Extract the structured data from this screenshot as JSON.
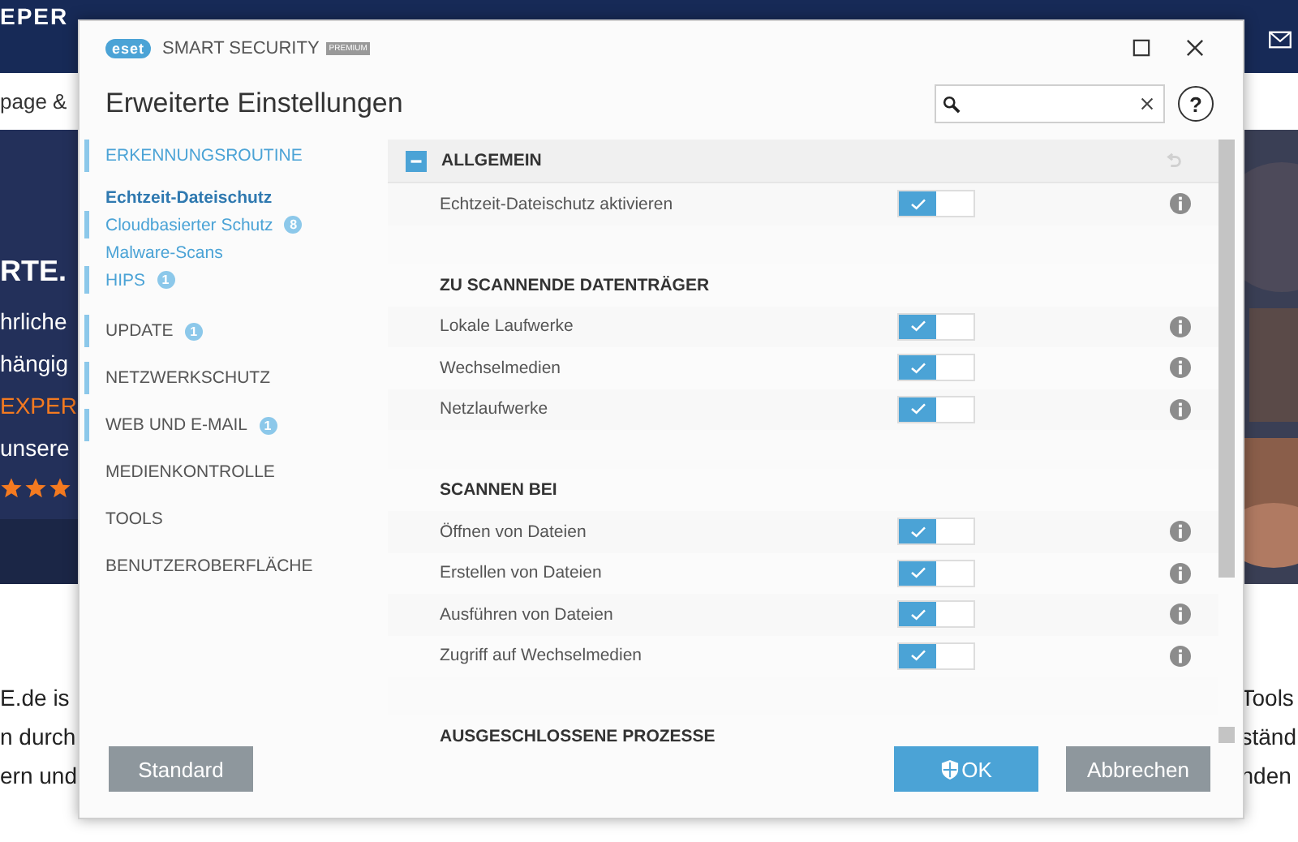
{
  "background_page": {
    "logo": "EPER",
    "nav_text": "page &",
    "hero_left": [
      {
        "text": "RTE.",
        "kind": "heading"
      },
      {
        "text": "hrliche",
        "kind": "plain"
      },
      {
        "text": "hängig",
        "kind": "plain"
      },
      {
        "text": "EXPER",
        "kind": "accent"
      },
      {
        "text": "unsere",
        "kind": "plain"
      }
    ],
    "stars": 3,
    "body_left": [
      "E.de is",
      "n durch",
      "ern und"
    ],
    "body_right": [
      "Tools",
      "ständ",
      "nden"
    ]
  },
  "window": {
    "brand": "eset",
    "product": "SMART SECURITY",
    "edition": "PREMIUM",
    "title": "Erweiterte Einstellungen",
    "help": "?"
  },
  "sidebar": {
    "items": [
      {
        "label": "ERKENNUNGSROUTINE",
        "marked": true,
        "selected": true,
        "children": [
          {
            "label": "Echtzeit-Dateischutz",
            "marked": false,
            "selected": true
          },
          {
            "label": "Cloudbasierter Schutz",
            "marked": true,
            "selected": false,
            "badge": "8"
          },
          {
            "label": "Malware-Scans",
            "marked": false,
            "selected": false
          },
          {
            "label": "HIPS",
            "marked": true,
            "selected": false,
            "badge": "1"
          }
        ]
      },
      {
        "label": "UPDATE",
        "marked": true,
        "selected": false,
        "badge": "1"
      },
      {
        "label": "NETZWERKSCHUTZ",
        "marked": true,
        "selected": false
      },
      {
        "label": "WEB UND E-MAIL",
        "marked": true,
        "selected": false,
        "badge": "1"
      },
      {
        "label": "MEDIENKONTROLLE",
        "marked": false,
        "selected": false
      },
      {
        "label": "TOOLS",
        "marked": false,
        "selected": false
      },
      {
        "label": "BENUTZEROBERFLÄCHE",
        "marked": false,
        "selected": false
      }
    ]
  },
  "sections": [
    {
      "title": "ALLGEMEIN",
      "kind": "main",
      "expanded": true,
      "items": [
        {
          "label": "Echtzeit-Dateischutz aktivieren",
          "on": true
        }
      ]
    },
    {
      "title": "ZU SCANNENDE DATENTRÄGER",
      "kind": "group",
      "items": [
        {
          "label": "Lokale Laufwerke",
          "on": true
        },
        {
          "label": "Wechselmedien",
          "on": true
        },
        {
          "label": "Netzlaufwerke",
          "on": true
        }
      ]
    },
    {
      "title": "SCANNEN BEI",
      "kind": "group",
      "items": [
        {
          "label": "Öffnen von Dateien",
          "on": true
        },
        {
          "label": "Erstellen von Dateien",
          "on": true
        },
        {
          "label": "Ausführen von Dateien",
          "on": true
        },
        {
          "label": "Zugriff auf Wechselmedien",
          "on": true
        }
      ]
    },
    {
      "title": "AUSGESCHLOSSENE PROZESSE",
      "kind": "group"
    }
  ],
  "buttons": [
    {
      "label": "Standard",
      "kind": "secondary"
    },
    {
      "label": "OK",
      "kind": "primary"
    },
    {
      "label": "Abbrechen",
      "kind": "secondary"
    }
  ]
}
